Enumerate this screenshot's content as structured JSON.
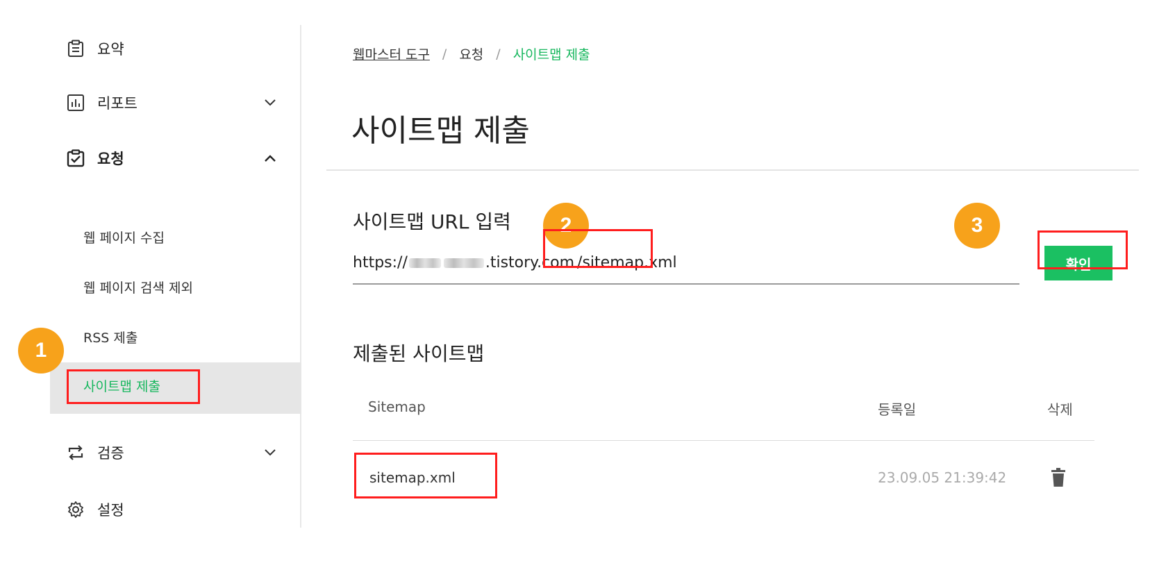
{
  "sidebar": {
    "items": [
      {
        "label": "요약",
        "icon": "clipboard-list-icon"
      },
      {
        "label": "리포트",
        "icon": "bar-chart-icon"
      },
      {
        "label": "요청",
        "icon": "clipboard-check-icon"
      },
      {
        "label": "검증",
        "icon": "repeat-arrows-icon"
      },
      {
        "label": "설정",
        "icon": "gear-icon"
      }
    ],
    "sub_items": [
      {
        "label": "웹 페이지 수집"
      },
      {
        "label": "웹 페이지 검색 제외"
      },
      {
        "label": "RSS 제출"
      },
      {
        "label": "사이트맵 제출"
      }
    ]
  },
  "annotations": {
    "badge1": "1",
    "badge2": "2",
    "badge3": "3"
  },
  "breadcrumb": {
    "root": "웹마스터 도구",
    "sep": "/",
    "parent": "요청",
    "current": "사이트맵 제출"
  },
  "page_title": "사이트맵 제출",
  "url_section": {
    "label": "사이트맵 URL 입력",
    "prefix": "https://",
    "domain_suffix": ".tistory.com",
    "path": "/sitemap.xml",
    "confirm_label": "확인"
  },
  "submitted": {
    "label": "제출된 사이트맵",
    "columns": [
      "Sitemap",
      "등록일",
      "삭제"
    ],
    "rows": [
      {
        "sitemap": "sitemap.xml",
        "date": "23.09.05 21:39:42"
      }
    ]
  },
  "colors": {
    "accent_green": "#17b75e",
    "button_green": "#1bc062",
    "highlight_red": "#ff1d1d",
    "badge_orange": "#f7a21b"
  }
}
